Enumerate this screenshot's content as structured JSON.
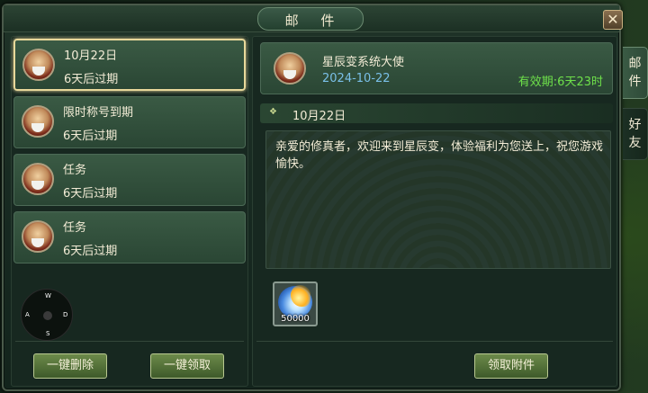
{
  "window": {
    "title": "邮 件",
    "close_glyph": "✕"
  },
  "side_tabs": [
    {
      "label": "邮\n件",
      "active": true
    },
    {
      "label": "好\n友",
      "active": false
    }
  ],
  "mail_list": [
    {
      "title": "10月22日",
      "expiry": "6天后过期",
      "selected": true
    },
    {
      "title": "限时称号到期",
      "expiry": "6天后过期",
      "selected": false
    },
    {
      "title": "任务",
      "expiry": "6天后过期",
      "selected": false
    },
    {
      "title": "任务",
      "expiry": "6天后过期",
      "selected": false
    }
  ],
  "joystick": {
    "up": "W",
    "left": "A",
    "down": "S",
    "right": "D"
  },
  "left_buttons": {
    "delete_all": "一键删除",
    "claim_all": "一键领取"
  },
  "detail": {
    "sender": "星辰变系统大使",
    "date": "2024-10-22",
    "validity": "有效期:6天23时",
    "section_title": "10月22日",
    "body": "亲爱的修真者，欢迎来到星辰变，体验福利为您送上，祝您游戏愉快。",
    "attachment": {
      "icon": "gold-ingot-icon",
      "count": "50000"
    },
    "claim_button": "领取附件"
  },
  "colors": {
    "expiry_green": "#6ee04a",
    "date_blue": "#7ac0e8",
    "selection_gold": "#e8d89a",
    "text_cream": "#f3ecd6"
  }
}
